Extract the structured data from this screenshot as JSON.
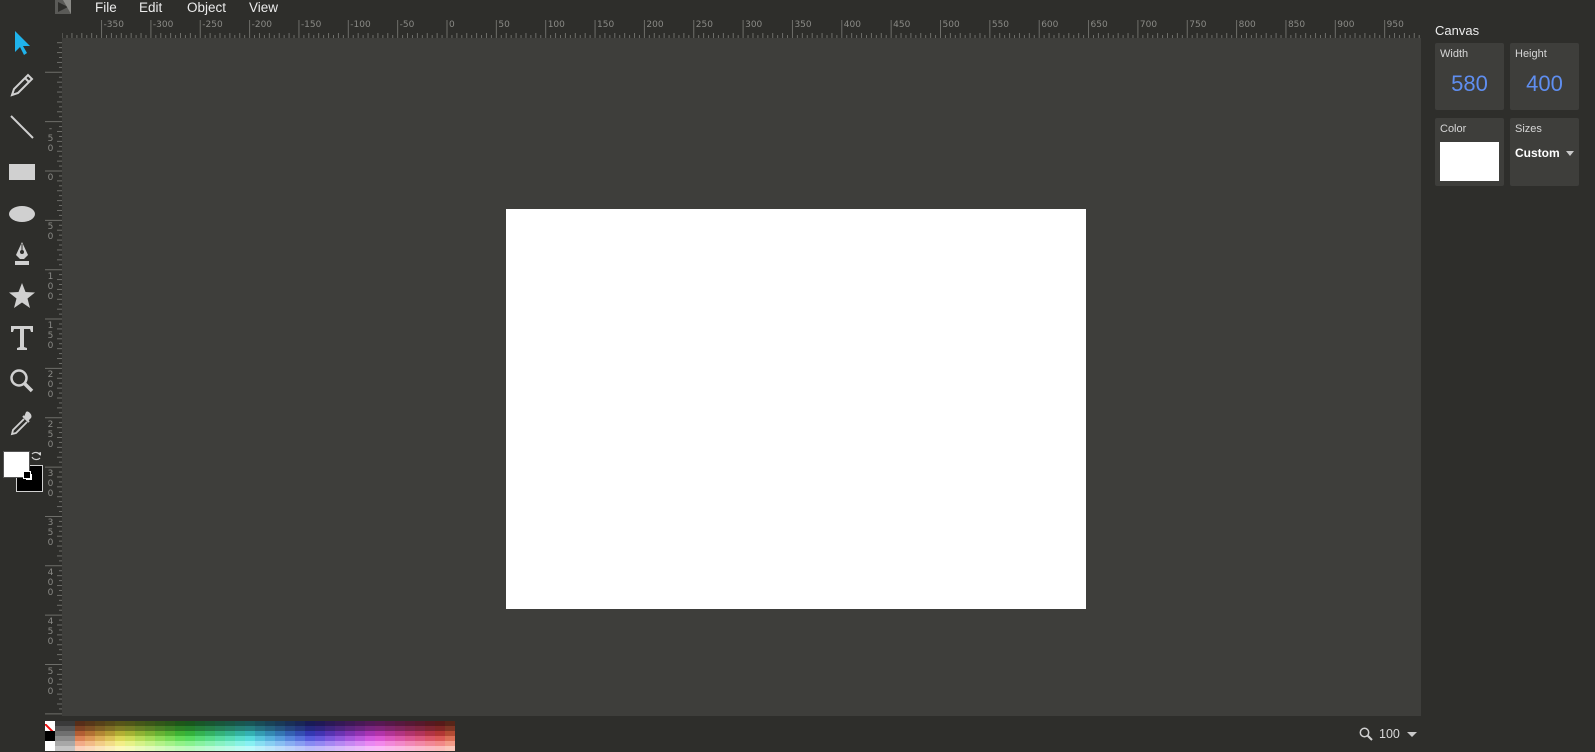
{
  "menu": {
    "items": [
      {
        "label": "File"
      },
      {
        "label": "Edit"
      },
      {
        "label": "Object"
      },
      {
        "label": "View"
      }
    ]
  },
  "tools": [
    {
      "name": "select-tool",
      "icon": "pointer-arrow-icon",
      "active": true
    },
    {
      "name": "pencil-tool",
      "icon": "pencil-icon"
    },
    {
      "name": "line-tool",
      "icon": "line-icon"
    },
    {
      "name": "rectangle-tool",
      "icon": "rectangle-icon"
    },
    {
      "name": "ellipse-tool",
      "icon": "ellipse-icon"
    },
    {
      "name": "path-tool",
      "icon": "pen-nib-icon"
    },
    {
      "name": "star-tool",
      "icon": "star-icon"
    },
    {
      "name": "text-tool",
      "icon": "text-icon"
    },
    {
      "name": "zoom-tool",
      "icon": "magnifier-icon"
    },
    {
      "name": "eyedropper-tool",
      "icon": "eyedropper-icon"
    }
  ],
  "colors": {
    "accent": "#1fb3ec",
    "value_blue": "#5f8ef0",
    "fill": "#ffffff",
    "stroke": "#000000",
    "workspace": "#3e3e3b",
    "chrome": "#2e2e2b"
  },
  "ruler": {
    "horizontal_labels": [
      "-350",
      "-300",
      "-250",
      "-200",
      "-150",
      "-100",
      "-50",
      "0",
      "50",
      "100",
      "150",
      "200",
      "250",
      "300",
      "350",
      "400",
      "450",
      "500",
      "550",
      "600",
      "650",
      "700",
      "750",
      "800",
      "850",
      "900",
      "950"
    ],
    "vertical_labels": [
      "-50",
      "0",
      "50",
      "100",
      "150",
      "200",
      "250",
      "300",
      "350",
      "400",
      "450",
      "500"
    ]
  },
  "panel": {
    "title": "Canvas",
    "width_label": "Width",
    "width_value": "580",
    "height_label": "Height",
    "height_value": "400",
    "color_label": "Color",
    "sizes_label": "Sizes",
    "sizes_value": "Custom"
  },
  "zoom": {
    "value": "100"
  }
}
